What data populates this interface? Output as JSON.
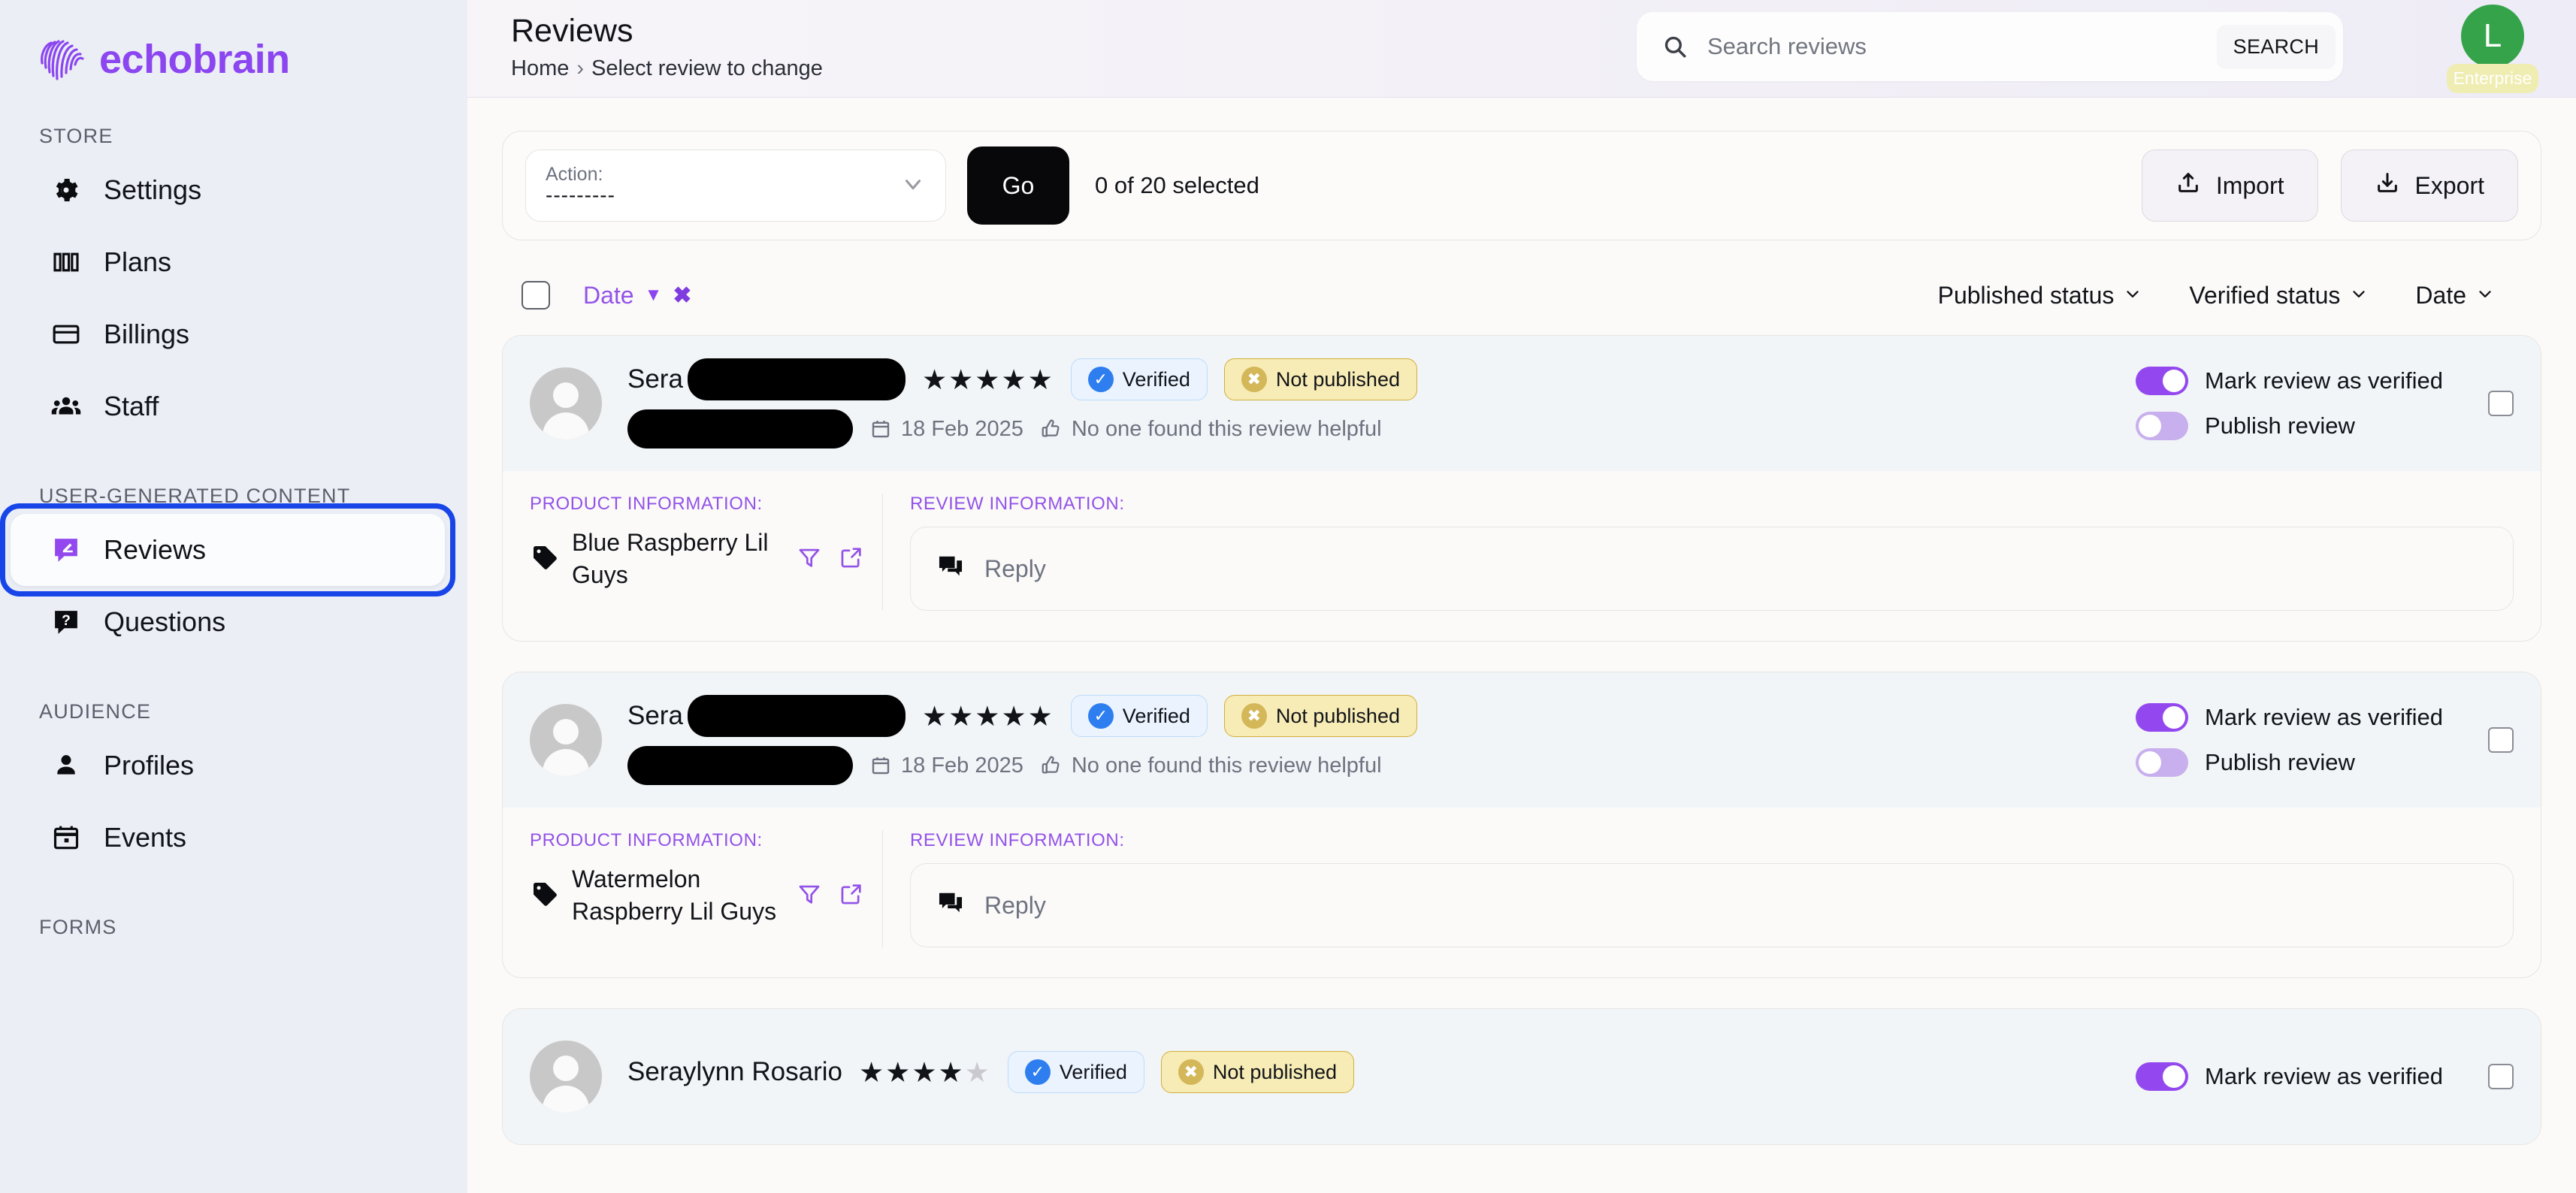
{
  "brand": {
    "name": "echobrain",
    "color": "#8b46f0"
  },
  "sidebar": {
    "sections": [
      {
        "label": "STORE",
        "items": [
          {
            "label": "Settings",
            "icon": "gear-icon"
          },
          {
            "label": "Plans",
            "icon": "columns-icon"
          },
          {
            "label": "Billings",
            "icon": "credit-card-icon"
          },
          {
            "label": "Staff",
            "icon": "people-icon"
          }
        ]
      },
      {
        "label": "USER-GENERATED CONTENT",
        "items": [
          {
            "label": "Reviews",
            "icon": "review-bubble-icon",
            "active": true
          },
          {
            "label": "Questions",
            "icon": "question-bubble-icon"
          }
        ]
      },
      {
        "label": "AUDIENCE",
        "items": [
          {
            "label": "Profiles",
            "icon": "person-icon"
          },
          {
            "label": "Events",
            "icon": "calendar-icon"
          }
        ]
      },
      {
        "label": "FORMS",
        "items": []
      }
    ]
  },
  "header": {
    "title": "Reviews",
    "breadcrumb_home": "Home",
    "breadcrumb_sep": "›",
    "breadcrumb_current": "Select review to change",
    "search_placeholder": "Search reviews",
    "search_value": "",
    "search_button": "SEARCH",
    "avatar_initial": "L",
    "plan_badge": "Enterprise",
    "avatar_color": "#35a34a",
    "plan_badge_color": "#f0edb2"
  },
  "toolbar": {
    "action_label": "Action:",
    "action_value": "---------",
    "go_label": "Go",
    "selection_text": "0 of 20 selected",
    "import_label": "Import",
    "export_label": "Export"
  },
  "list_header": {
    "sort_field": "Date",
    "sort_direction": "desc",
    "filters": [
      "Published status",
      "Verified status",
      "Date"
    ]
  },
  "reviews": [
    {
      "reviewer_prefix": "Sera",
      "reviewer_redacted": true,
      "rating": 5,
      "max_rating": 5,
      "verified_label": "Verified",
      "published_label": "Not published",
      "date": "18 Feb 2025",
      "helpful_text": "No one found this review helpful",
      "verify_toggle_label": "Mark review as verified",
      "verify_toggle_on": true,
      "publish_toggle_label": "Publish review",
      "publish_toggle_on": false,
      "product_label": "PRODUCT INFORMATION:",
      "product_name": "Blue Raspberry Lil Guys",
      "review_label": "REVIEW INFORMATION:",
      "reply_placeholder": "Reply"
    },
    {
      "reviewer_prefix": "Sera",
      "reviewer_redacted": true,
      "rating": 5,
      "max_rating": 5,
      "verified_label": "Verified",
      "published_label": "Not published",
      "date": "18 Feb 2025",
      "helpful_text": "No one found this review helpful",
      "verify_toggle_label": "Mark review as verified",
      "verify_toggle_on": true,
      "publish_toggle_label": "Publish review",
      "publish_toggle_on": false,
      "product_label": "PRODUCT INFORMATION:",
      "product_name": "Watermelon Raspberry Lil Guys",
      "review_label": "REVIEW INFORMATION:",
      "reply_placeholder": "Reply"
    },
    {
      "reviewer_prefix": "Seraylynn Rosario",
      "reviewer_redacted": false,
      "rating": 4,
      "max_rating": 5,
      "verified_label": "Verified",
      "published_label": "Not published",
      "verify_toggle_label": "Mark review as verified",
      "verify_toggle_on": true
    }
  ]
}
